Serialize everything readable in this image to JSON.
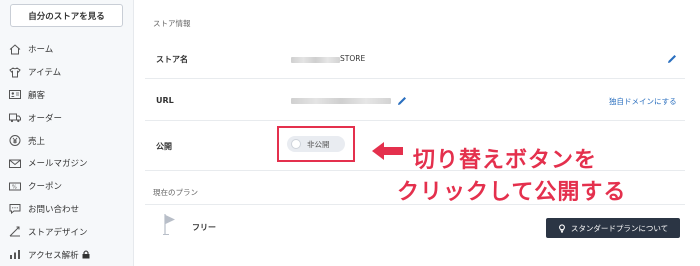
{
  "sidebar": {
    "store_button": "自分のストアを見る",
    "items": [
      {
        "label": "ホーム",
        "icon": "home-icon"
      },
      {
        "label": "アイテム",
        "icon": "shirt-icon"
      },
      {
        "label": "顧客",
        "icon": "id-card-icon"
      },
      {
        "label": "オーダー",
        "icon": "truck-icon"
      },
      {
        "label": "売上",
        "icon": "yen-icon"
      },
      {
        "label": "メールマガジン",
        "icon": "mail-icon"
      },
      {
        "label": "クーポン",
        "icon": "coupon-icon"
      },
      {
        "label": "お問い合わせ",
        "icon": "chat-icon"
      },
      {
        "label": "ストアデザイン",
        "icon": "design-icon"
      },
      {
        "label": "アクセス解析",
        "icon": "chart-icon",
        "locked": true
      }
    ]
  },
  "main": {
    "store_info_title": "ストア情報",
    "store_name_label": "ストア名",
    "store_name_value": "STORE",
    "url_label": "URL",
    "domain_link": "独自ドメインにする",
    "public_label": "公開",
    "toggle_label": "非公開",
    "plan_title": "現在のプラン",
    "plan_name": "フリー",
    "plan_button": "スタンダードプランについて"
  },
  "annotation": {
    "line1": "切り替えボタンを",
    "line2": "クリックして公開する",
    "color": "#e4304d"
  }
}
